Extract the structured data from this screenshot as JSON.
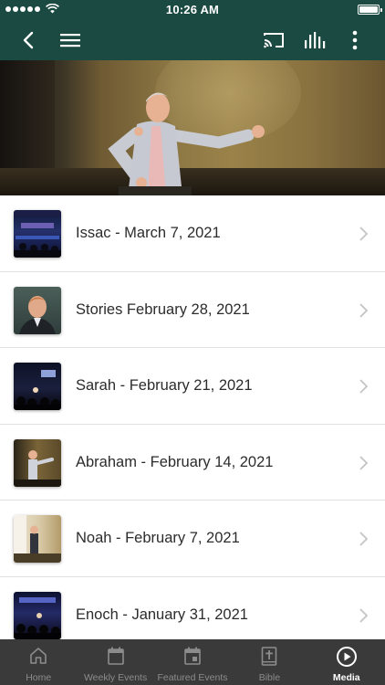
{
  "status": {
    "time": "10:26 AM"
  },
  "nav": {
    "back_icon": "chevron-left-icon",
    "menu_icon": "hamburger-menu-icon",
    "cast_icon": "cast-icon",
    "audio_icon": "audio-levels-icon",
    "more_icon": "more-vertical-icon",
    "color": "#1b4a42"
  },
  "hero": {
    "description_icon": "speaker-on-stage-photo"
  },
  "media_list": [
    {
      "title": "Issac - March 7, 2021"
    },
    {
      "title": "Stories February 28, 2021"
    },
    {
      "title": "Sarah - February 21, 2021"
    },
    {
      "title": "Abraham - February 14, 2021"
    },
    {
      "title": "Noah - February 7, 2021"
    },
    {
      "title": "Enoch - January 31, 2021"
    }
  ],
  "tabs": [
    {
      "label": "Home",
      "icon": "home-icon",
      "active": false
    },
    {
      "label": "Weekly Events",
      "icon": "calendar-icon",
      "active": false
    },
    {
      "label": "Featured Events",
      "icon": "calendar-event-icon",
      "active": false
    },
    {
      "label": "Bible",
      "icon": "bible-icon",
      "active": false
    },
    {
      "label": "Media",
      "icon": "play-circle-icon",
      "active": true
    }
  ],
  "colors": {
    "brand": "#1b4a42",
    "tab_bar": "#3a3a3a",
    "tab_active": "#ffffff",
    "tab_inactive": "#8c8c8c"
  }
}
